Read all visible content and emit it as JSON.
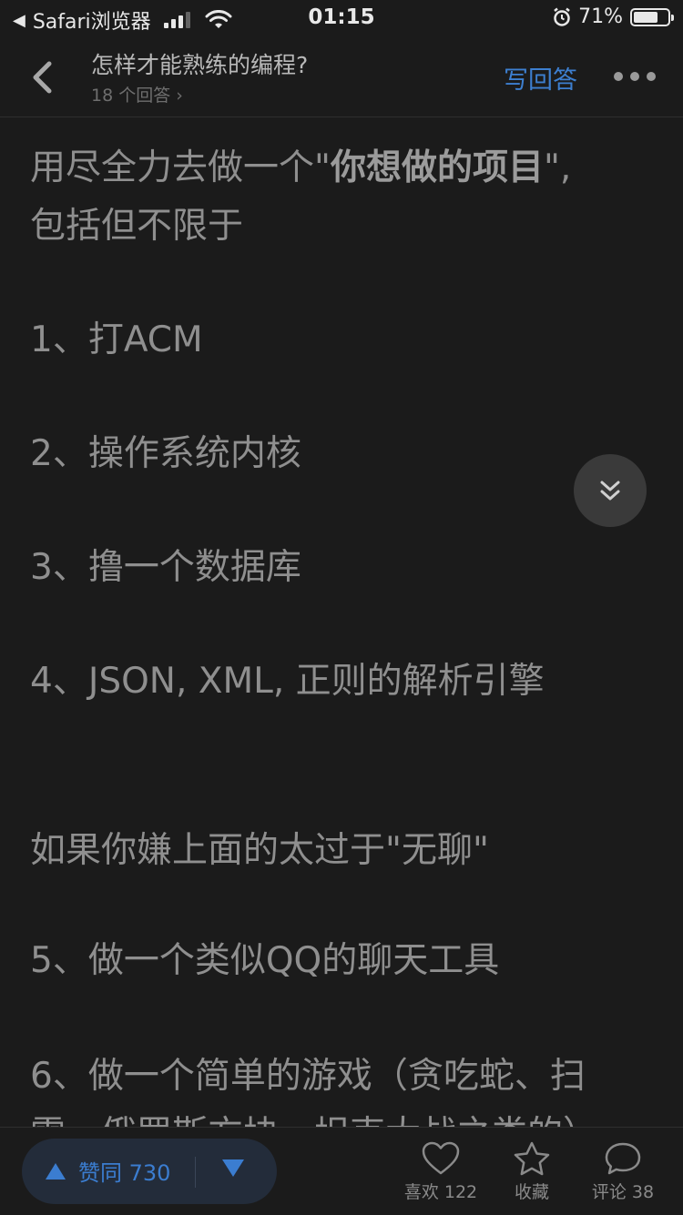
{
  "status_bar": {
    "back_app": "Safari浏览器",
    "time": "01:15",
    "battery": "71%",
    "battery_level": 0.71
  },
  "nav": {
    "title": "怎样才能熟练的编程?",
    "subtitle": "18 个回答 ›",
    "write_answer": "写回答"
  },
  "content": {
    "intro_1a": "用尽全力去做一个\"",
    "intro_1b": "你想做的项目",
    "intro_1c": "\",",
    "intro_2": "包括但不限于",
    "items": [
      "1、打ACM",
      "2、操作系统内核",
      "3、撸一个数据库",
      "4、JSON, XML, 正则的解析引擎"
    ],
    "transition": "如果你嫌上面的太过于\"无聊\"",
    "items2": [
      "5、做一个类似QQ的聊天工具",
      "6、做一个简单的游戏（贪吃蛇、扫",
      "雷，俄罗斯方块，坦克大战之类的）"
    ]
  },
  "bottom_bar": {
    "upvote_label": "赞同 730",
    "like_label": "喜欢 122",
    "collect_label": "收藏",
    "comment_label": "评论 38"
  }
}
